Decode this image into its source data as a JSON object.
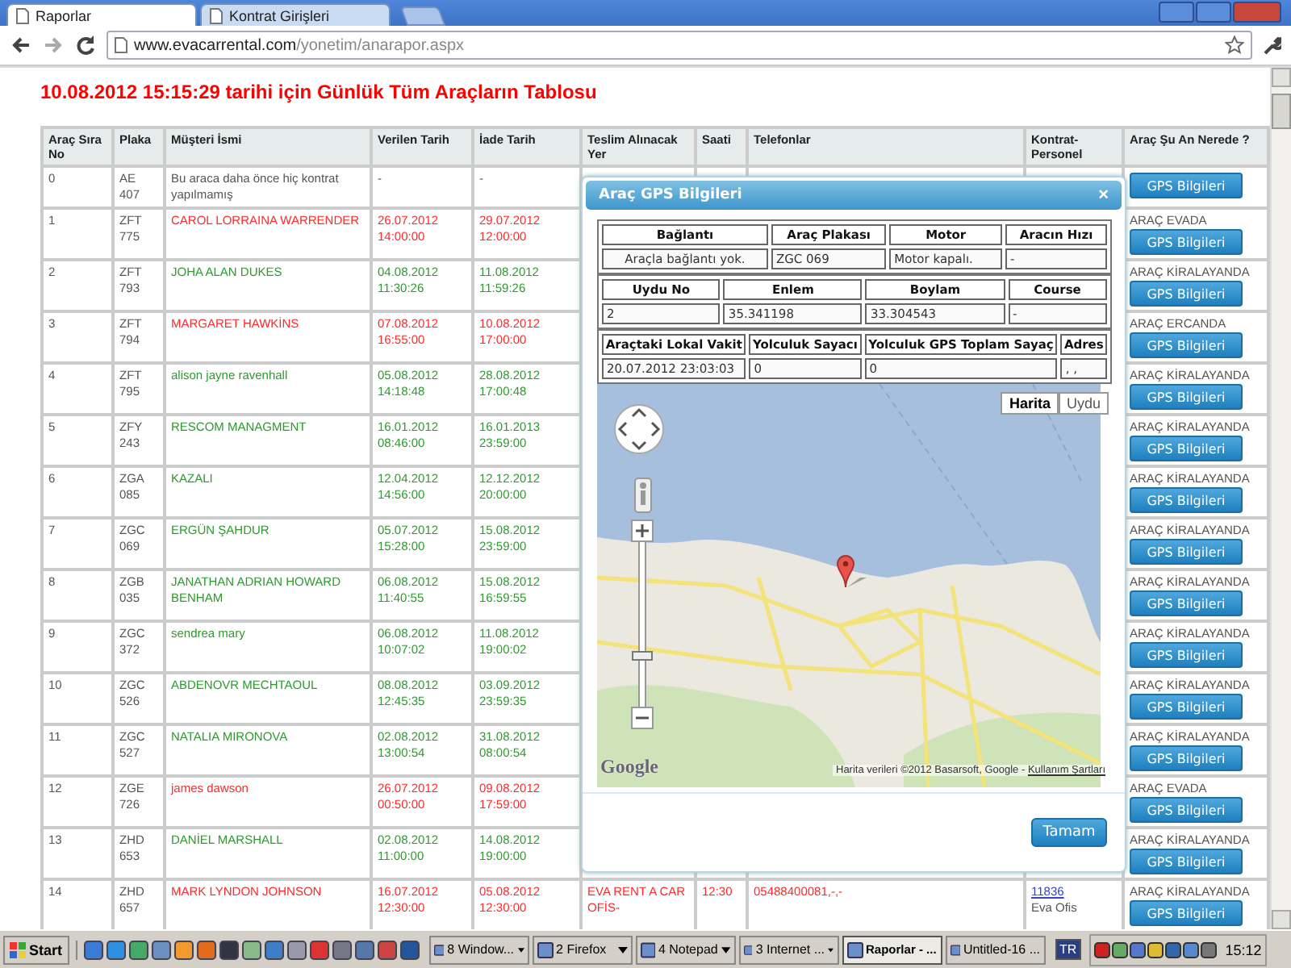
{
  "browser": {
    "tabs": [
      {
        "label": "Raporlar",
        "selected": true
      },
      {
        "label": "Kontrat Girişleri",
        "selected": false
      }
    ],
    "url_host": "www.evacarrental.com",
    "url_path": "/yonetim/anarapor.aspx"
  },
  "page_title": "10.08.2012 15:15:29 tarihi için Günlük Tüm Araçların Tablosu",
  "table": {
    "columns": [
      "Araç Sıra No",
      "Plaka",
      "Müşteri İsmi",
      "Verilen Tarih",
      "İade Tarih",
      "Teslim Alınacak Yer",
      "Saati",
      "Telefonlar",
      "Kontrat-Personel",
      "Araç Şu An Nerede ?"
    ],
    "rows": [
      {
        "no": "0",
        "plate": "AE 407",
        "customer": "Bu araca daha önce hiç kontrat yapılmamış",
        "given": [
          "-"
        ],
        "returned": [
          "-"
        ],
        "color": "#555555",
        "button": "GPS Bilgileri"
      },
      {
        "no": "1",
        "plate": "ZFT 775",
        "customer": "CAROL LORRAINA WARRENDER",
        "given": [
          "26.07.2012",
          "14:00:00"
        ],
        "returned": [
          "29.07.2012",
          "12:00:00"
        ],
        "color": "#ff2a2a",
        "location": "ARAÇ EVADA",
        "button": "GPS Bilgileri"
      },
      {
        "no": "2",
        "plate": "ZFT 793",
        "customer": "JOHA ALAN DUKES",
        "given": [
          "04.08.2012",
          "11:30:26"
        ],
        "returned": [
          "11.08.2012",
          "11:59:26"
        ],
        "color": "#2e9a2e",
        "location": "ARAÇ KİRALAYANDA",
        "button": "GPS Bilgileri"
      },
      {
        "no": "3",
        "plate": "ZFT 794",
        "customer": "MARGARET HAWKİNS",
        "given": [
          "07.08.2012",
          "16:55:00"
        ],
        "returned": [
          "10.08.2012",
          "17:00:00"
        ],
        "color": "#ff2a2a",
        "location": "ARAÇ ERCANDA",
        "button": "GPS Bilgileri"
      },
      {
        "no": "4",
        "plate": "ZFT 795",
        "customer": "alison jayne ravenhall",
        "given": [
          "05.08.2012",
          "14:18:48"
        ],
        "returned": [
          "28.08.2012",
          "17:00:48"
        ],
        "color": "#2e9a2e",
        "location": "ARAÇ KİRALAYANDA",
        "button": "GPS Bilgileri"
      },
      {
        "no": "5",
        "plate": "ZFY 243",
        "customer": "RESCOM MANAGMENT",
        "given": [
          "16.01.2012",
          "08:46:00"
        ],
        "returned": [
          "16.01.2013",
          "23:59:00"
        ],
        "color": "#2e9a2e",
        "location": "ARAÇ KİRALAYANDA",
        "button": "GPS Bilgileri"
      },
      {
        "no": "6",
        "plate": "ZGA 085",
        "customer": "KAZALI",
        "given": [
          "12.04.2012",
          "14:56:00"
        ],
        "returned": [
          "12.12.2012",
          "20:00:00"
        ],
        "color": "#2e9a2e",
        "location": "ARAÇ KİRALAYANDA",
        "button": "GPS Bilgileri"
      },
      {
        "no": "7",
        "plate": "ZGC 069",
        "customer": "ERGÜN ŞAHDUR",
        "given": [
          "05.07.2012",
          "15:28:00"
        ],
        "returned": [
          "15.08.2012",
          "23:59:00"
        ],
        "color": "#2e9a2e",
        "location": "ARAÇ KİRALAYANDA",
        "button": "GPS Bilgileri"
      },
      {
        "no": "8",
        "plate": "ZGB 035",
        "customer": "JANATHAN ADRIAN HOWARD BENHAM",
        "given": [
          "06.08.2012",
          "11:40:55"
        ],
        "returned": [
          "15.08.2012",
          "16:59:55"
        ],
        "color": "#2e9a2e",
        "location": "ARAÇ KİRALAYANDA",
        "button": "GPS Bilgileri"
      },
      {
        "no": "9",
        "plate": "ZGC 372",
        "customer": "sendrea mary",
        "given": [
          "06.08.2012",
          "10:07:02"
        ],
        "returned": [
          "11.08.2012",
          "19:00:02"
        ],
        "color": "#2e9a2e",
        "location": "ARAÇ KİRALAYANDA",
        "button": "GPS Bilgileri"
      },
      {
        "no": "10",
        "plate": "ZGC 526",
        "customer": "ABDENOVR MECHTAOUL",
        "given": [
          "08.08.2012",
          "12:45:35"
        ],
        "returned": [
          "03.09.2012",
          "23:59:35"
        ],
        "color": "#2e9a2e",
        "location": "ARAÇ KİRALAYANDA",
        "button": "GPS Bilgileri"
      },
      {
        "no": "11",
        "plate": "ZGC 527",
        "customer": "NATALIA MIRONOVA",
        "given": [
          "02.08.2012",
          "13:00:54"
        ],
        "returned": [
          "31.08.2012",
          "08:00:54"
        ],
        "color": "#2e9a2e",
        "location": "ARAÇ KİRALAYANDA",
        "button": "GPS Bilgileri"
      },
      {
        "no": "12",
        "plate": "ZGE 726",
        "customer": "james dawson",
        "given": [
          "26.07.2012",
          "00:50:00"
        ],
        "returned": [
          "09.08.2012",
          "17:59:00"
        ],
        "color": "#ff2a2a",
        "location": "ARAÇ EVADA",
        "button": "GPS Bilgileri"
      },
      {
        "no": "13",
        "plate": "ZHD 653",
        "customer": "DANİEL MARSHALL",
        "given": [
          "02.08.2012",
          "11:00:00"
        ],
        "returned": [
          "14.08.2012",
          "19:00:00"
        ],
        "color": "#2e9a2e",
        "location": "ARAÇ KİRALAYANDA",
        "button": "GPS Bilgileri"
      },
      {
        "no": "14",
        "plate": "ZHD 657",
        "customer": "MARK LYNDON JOHNSON",
        "given": [
          "16.07.2012",
          "12:30:00"
        ],
        "returned": [
          "05.08.2012",
          "12:30:00"
        ],
        "color": "#ff2a2a",
        "pickup": "EVA RENT A CAR OFİS-",
        "time": "12:30",
        "phones": "05488400081,-,-",
        "contract_link": "11836",
        "staff": "Eva Ofis",
        "location": "ARAÇ KİRALAYANDA",
        "button": "GPS Bilgileri"
      }
    ]
  },
  "dialog": {
    "title": "Araç GPS Bilgileri",
    "close": "×",
    "grids": [
      {
        "headers": [
          "Bağlantı",
          "Araç Plakası",
          "Motor",
          "Aracın Hızı"
        ],
        "values": [
          "Araçla bağlantı yok.",
          "ZGC 069",
          "Motor kapalı.",
          "-"
        ]
      },
      {
        "headers": [
          "Uydu No",
          "Enlem",
          "Boylam",
          "Course"
        ],
        "values": [
          "2",
          "35.341198",
          "33.304543",
          "-"
        ]
      },
      {
        "headers": [
          "Araçtaki Lokal Vakit",
          "Yolculuk Sayacı",
          "Yolculuk GPS Toplam Sayaç",
          "Adres"
        ],
        "values": [
          "20.07.2012 23:03:03",
          "0",
          "0",
          ", ,"
        ]
      }
    ],
    "map": {
      "types": [
        {
          "label": "Harita",
          "selected": true
        },
        {
          "label": "Uydu",
          "selected": false
        }
      ],
      "zoom": {
        "level": 0.29
      },
      "logo": "Google",
      "attribution": "Harita verileri ©2012 Basarsoft, Google - ",
      "terms_link": "Kullanım Şartları"
    },
    "ok_button": "Tamam"
  },
  "taskbar": {
    "start": "Start",
    "tasks": [
      {
        "label": "8 Window...",
        "group": true,
        "selected": false
      },
      {
        "label": "2 Firefox",
        "group": true,
        "selected": false
      },
      {
        "label": "4 Notepad",
        "group": true,
        "selected": false
      },
      {
        "label": "3 Internet ...",
        "group": true,
        "selected": false
      },
      {
        "label": "Raporlar - ...",
        "group": false,
        "selected": true
      },
      {
        "label": "Untitled-16 ...",
        "group": false,
        "selected": false
      }
    ],
    "language": "TR",
    "clock": "15:12"
  }
}
